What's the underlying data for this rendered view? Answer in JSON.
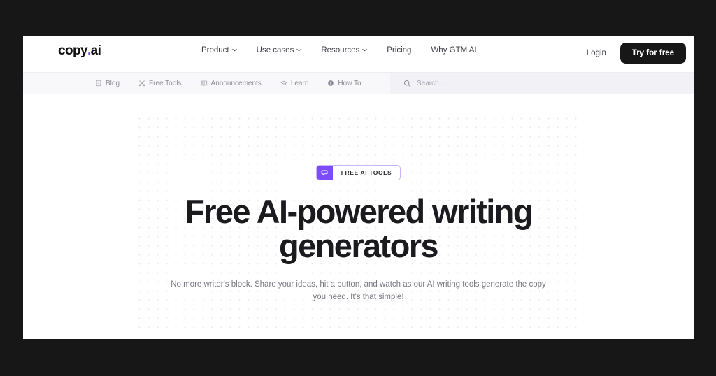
{
  "brand": {
    "name_part1": "copy",
    "dot": ".",
    "name_part2": "ai",
    "accent_color": "#7C4DFF"
  },
  "topnav": {
    "items": [
      {
        "label": "Product",
        "has_chevron": true
      },
      {
        "label": "Use cases",
        "has_chevron": true
      },
      {
        "label": "Resources",
        "has_chevron": true
      },
      {
        "label": "Pricing",
        "has_chevron": false
      },
      {
        "label": "Why GTM AI",
        "has_chevron": false
      }
    ],
    "login_label": "Login",
    "cta_label": "Try for free"
  },
  "subnav": {
    "items": [
      {
        "label": "Blog",
        "icon": "book-icon"
      },
      {
        "label": "Free Tools",
        "icon": "tools-icon"
      },
      {
        "label": "Announcements",
        "icon": "announcement-icon"
      },
      {
        "label": "Learn",
        "icon": "graduation-cap-icon"
      },
      {
        "label": "How To",
        "icon": "info-circle-icon"
      }
    ],
    "search": {
      "icon": "search-icon",
      "placeholder": "Search...",
      "value": ""
    }
  },
  "hero": {
    "badge": {
      "icon": "chat-bubble-icon",
      "label": "FREE AI TOOLS",
      "accent_color": "#7C4DFF",
      "border_color": "#cbb6f5"
    },
    "headline": "Free AI-powered writing generators",
    "subtitle": "No more writer's block. Share your ideas, hit a button, and watch as our AI writing tools generate the copy you need. It's that simple!"
  }
}
